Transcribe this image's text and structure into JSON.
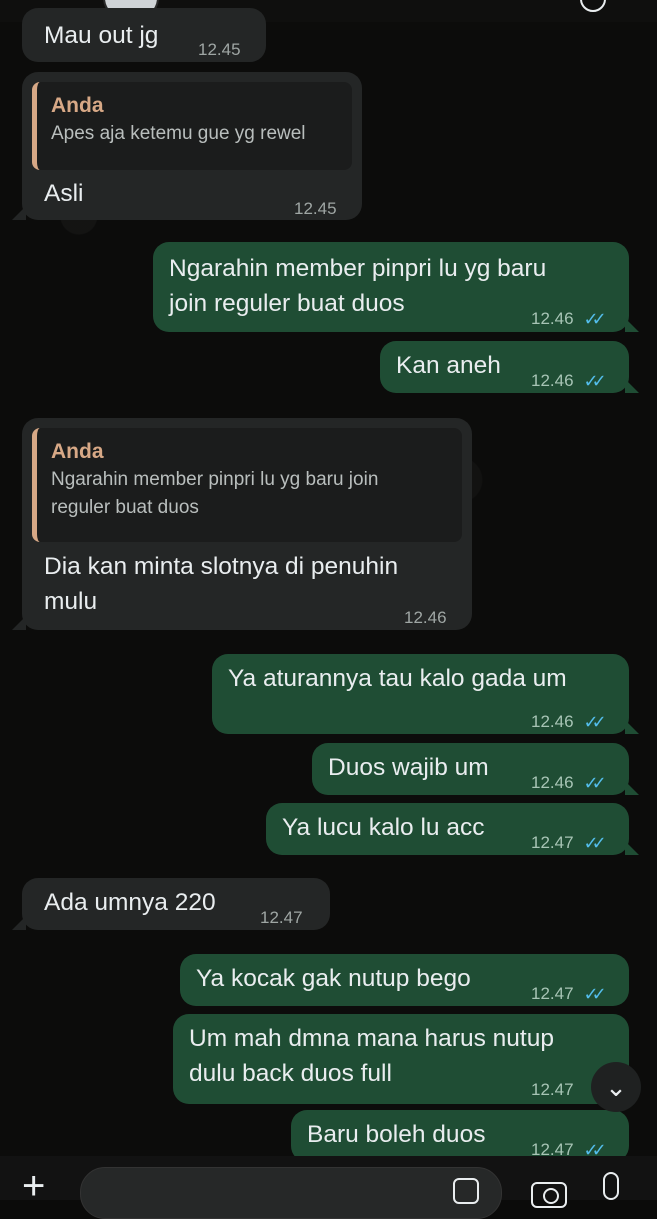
{
  "header": {
    "avatar_icon": "contact-avatar",
    "action_icon": "call-icon"
  },
  "messages": [
    {
      "text": "Mau out jg",
      "time": "12.45"
    },
    {
      "quote_name": "Anda",
      "quote_text": "Apes aja ketemu gue yg rewel",
      "text": "Asli",
      "time": "12.45"
    },
    {
      "line1": "Ngarahin member pinpri lu yg baru",
      "line2": "join reguler buat duos",
      "time": "12.46",
      "ticks": "✓✓"
    },
    {
      "text": "Kan aneh",
      "time": "12.46",
      "ticks": "✓✓"
    },
    {
      "quote_name": "Anda",
      "quote_line1": "Ngarahin member pinpri lu yg baru join",
      "quote_line2": "reguler buat duos",
      "line1": "Dia kan minta slotnya di penuhin",
      "line2": "mulu",
      "time": "12.46"
    },
    {
      "text": "Ya aturannya tau kalo gada um",
      "time": "12.46",
      "ticks": "✓✓"
    },
    {
      "text": "Duos wajib um",
      "time": "12.46",
      "ticks": "✓✓"
    },
    {
      "text": "Ya lucu kalo lu acc",
      "time": "12.47",
      "ticks": "✓✓"
    },
    {
      "text": "Ada umnya 220",
      "time": "12.47"
    },
    {
      "text": "Ya kocak gak nutup bego",
      "time": "12.47",
      "ticks": "✓✓"
    },
    {
      "line1": "Um mah dmna mana harus nutup",
      "line2": "dulu back duos full",
      "time": "12.47"
    },
    {
      "text": "Baru boleh duos",
      "time": "12.47",
      "ticks": "✓✓"
    }
  ],
  "scroll_down": {
    "icon": "chevron-down-icon",
    "glyph": "⌄"
  },
  "composer": {
    "plus_glyph": "+",
    "placeholder": ""
  },
  "colors": {
    "incoming": "#242626",
    "outgoing": "#1f4d34",
    "quote_accent": "#d7a886",
    "read_ticks": "#53bdeb"
  }
}
